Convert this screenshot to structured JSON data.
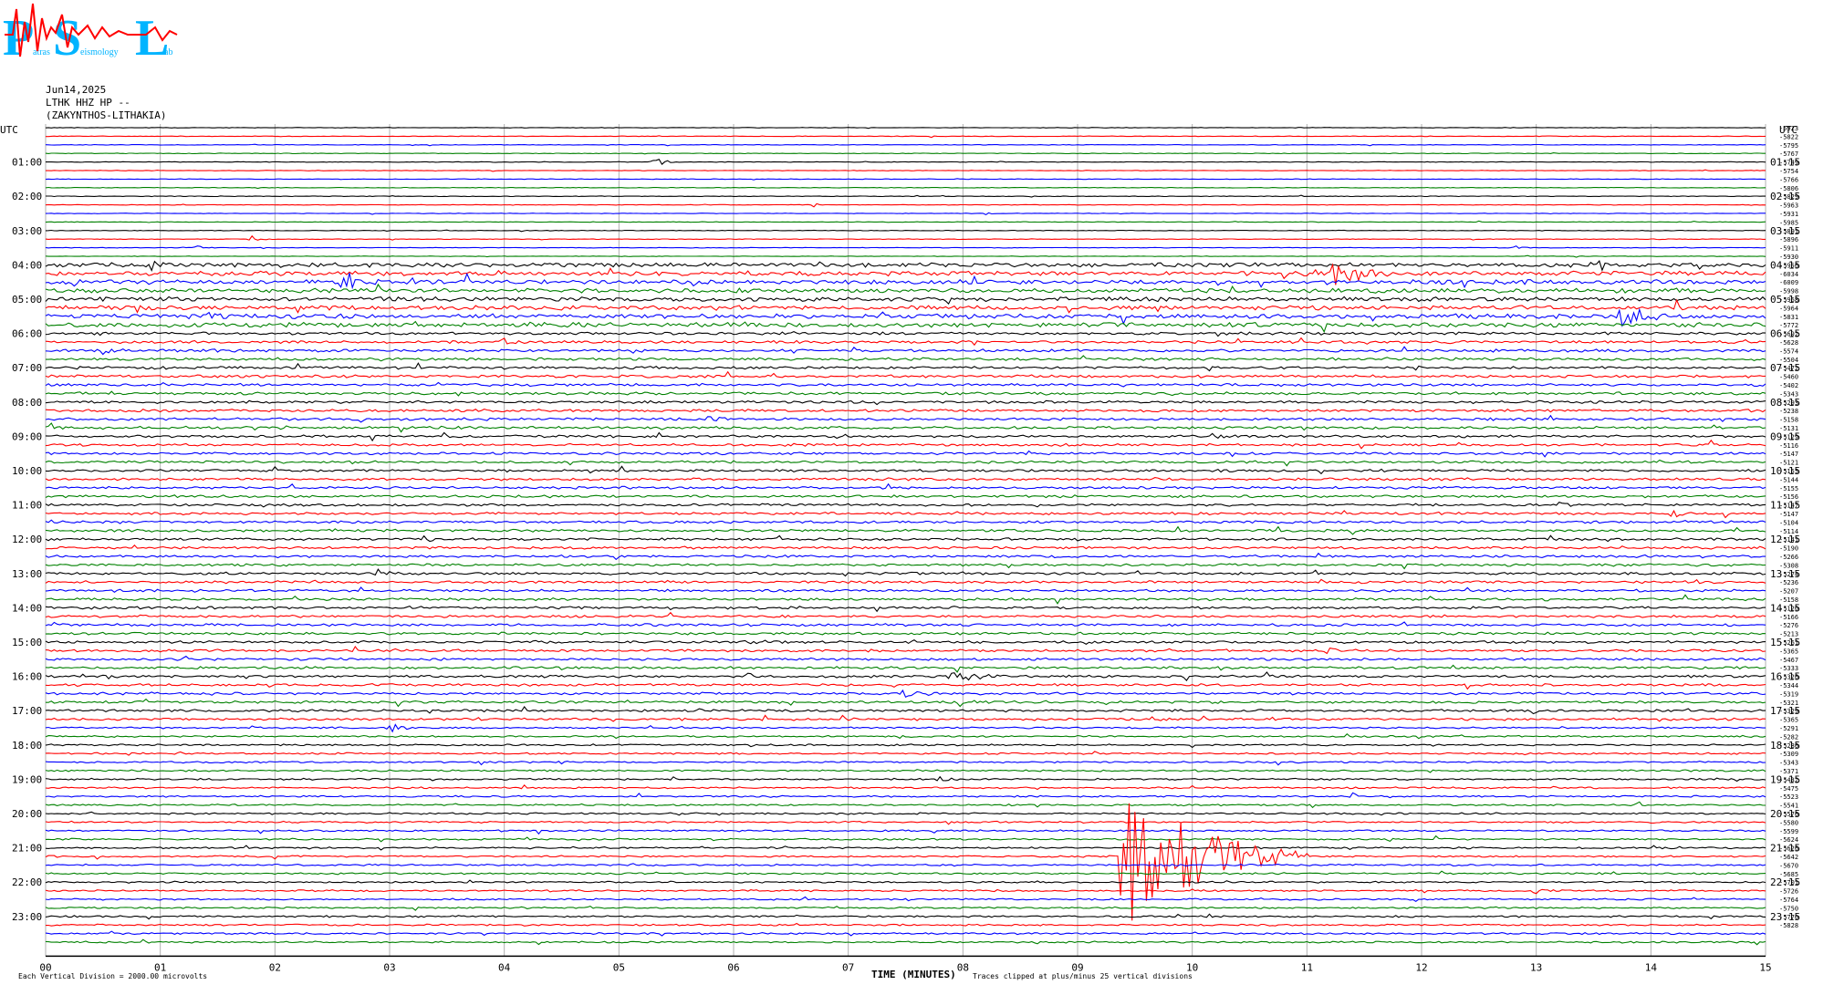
{
  "logo": {
    "big_letters": [
      "P",
      "S",
      "L"
    ],
    "small_words": [
      "atras",
      "eismology",
      "ab"
    ],
    "colors": {
      "letters": "#00b4ff",
      "wave": "#ff0000"
    }
  },
  "header": {
    "date": "Jun14,2025",
    "station": "LTHK HHZ HP --",
    "location": "(ZAKYNTHOS-LITHAKIA)"
  },
  "chart_data": {
    "type": "seismogram",
    "utc_label_left": "UTC",
    "utc_label_right": "UTC",
    "xlabel": "TIME (MINUTES)",
    "xlim": [
      0,
      15
    ],
    "x_ticks": [
      "00",
      "01",
      "02",
      "03",
      "04",
      "05",
      "06",
      "07",
      "08",
      "09",
      "10",
      "11",
      "12",
      "13",
      "14",
      "15"
    ],
    "left_hours": [
      "01:00",
      "02:00",
      "03:00",
      "04:00",
      "05:00",
      "06:00",
      "07:00",
      "08:00",
      "09:00",
      "10:00",
      "11:00",
      "12:00",
      "13:00",
      "14:00",
      "15:00",
      "16:00",
      "17:00",
      "18:00",
      "19:00",
      "20:00",
      "21:00",
      "22:00",
      "23:00"
    ],
    "right_hours": [
      "01:15",
      "02:15",
      "03:15",
      "04:15",
      "05:15",
      "06:15",
      "07:15",
      "08:15",
      "09:15",
      "10:15",
      "11:15",
      "12:15",
      "13:15",
      "14:15",
      "15:15",
      "16:15",
      "17:15",
      "18:15",
      "19:15",
      "20:15",
      "21:15",
      "22:15",
      "23:15"
    ],
    "trace_count": 96,
    "trace_colors": [
      "#000000",
      "#ff0000",
      "#0000ff",
      "#008000"
    ],
    "trace_offsets": [
      -5923,
      -5822,
      -5795,
      -5767,
      -5749,
      -5754,
      -5766,
      -5806,
      -5829,
      -5963,
      -5931,
      -5985,
      -5891,
      -5896,
      -5911,
      -5930,
      -5956,
      -6034,
      -6009,
      -5998,
      -5968,
      -5964,
      -5831,
      -5772,
      -5692,
      -5628,
      -5574,
      -5504,
      -5472,
      -5460,
      -5402,
      -5343,
      -5293,
      -5238,
      -5158,
      -5131,
      -5129,
      -5116,
      -5147,
      -5121,
      -5155,
      -5144,
      -5155,
      -5156,
      -5147,
      -5147,
      -5104,
      -5114,
      -5141,
      -5190,
      -5266,
      -5308,
      -5274,
      -5236,
      -5207,
      -5158,
      -5120,
      -5166,
      -5276,
      -5213,
      -5261,
      -5365,
      -5467,
      -5333,
      -5326,
      -5344,
      -5319,
      -5321,
      -5329,
      -5365,
      -5291,
      -5282,
      -5286,
      -5309,
      -5343,
      -5371,
      -5432,
      -5475,
      -5523,
      -5541,
      -5576,
      -5580,
      -5599,
      -5624,
      -5626,
      -5642,
      -5670,
      -5685,
      -5701,
      -5726,
      -5764,
      -5750,
      -5770,
      -5828
    ],
    "footer_left": "Each Vertical Division = 2000.00 microvolts",
    "footer_right": "Traces clipped at plus/minus 25 vertical divisions",
    "events": [
      {
        "trace": 4,
        "minute": 5.3,
        "amp": 0.8,
        "dur": 0.25
      },
      {
        "trace": 9,
        "minute": 6.7,
        "amp": 0.25,
        "dur": 0.1
      },
      {
        "trace": 10,
        "minute": 8.2,
        "amp": 0.25,
        "dur": 0.1
      },
      {
        "trace": 13,
        "minute": 1.8,
        "amp": 0.45,
        "dur": 0.2
      },
      {
        "trace": 14,
        "minute": 1.3,
        "amp": 0.3,
        "dur": 0.2
      },
      {
        "trace": 14,
        "minute": 12.8,
        "amp": 0.3,
        "dur": 0.15
      },
      {
        "trace": 16,
        "minute": 0.9,
        "amp": 0.6,
        "dur": 0.2
      },
      {
        "trace": 17,
        "minute": 11.25,
        "amp": 2.5,
        "dur": 0.45
      },
      {
        "trace": 18,
        "minute": 2.6,
        "amp": 1.5,
        "dur": 0.45
      },
      {
        "trace": 22,
        "minute": 13.75,
        "amp": 1.2,
        "dur": 0.45
      },
      {
        "trace": 22,
        "minute": 1.4,
        "amp": 0.5,
        "dur": 0.2
      },
      {
        "trace": 25,
        "minute": 4.0,
        "amp": 0.4,
        "dur": 0.2
      },
      {
        "trace": 26,
        "minute": 0.5,
        "amp": 0.4,
        "dur": 0.2
      },
      {
        "trace": 34,
        "minute": 5.8,
        "amp": 0.5,
        "dur": 0.2
      },
      {
        "trace": 35,
        "minute": 0.05,
        "amp": 0.6,
        "dur": 0.2
      },
      {
        "trace": 36,
        "minute": 10.2,
        "amp": 0.5,
        "dur": 0.15
      },
      {
        "trace": 44,
        "minute": 13.2,
        "amp": 0.4,
        "dur": 0.2
      },
      {
        "trace": 45,
        "minute": 14.2,
        "amp": 0.5,
        "dur": 0.2
      },
      {
        "trace": 48,
        "minute": 3.3,
        "amp": 0.4,
        "dur": 0.25
      },
      {
        "trace": 52,
        "minute": 2.9,
        "amp": 0.4,
        "dur": 0.2
      },
      {
        "trace": 56,
        "minute": 3.2,
        "amp": 0.4,
        "dur": 0.2
      },
      {
        "trace": 60,
        "minute": 6.1,
        "amp": 0.45,
        "dur": 0.5
      },
      {
        "trace": 61,
        "minute": 11.2,
        "amp": 0.4,
        "dur": 0.15
      },
      {
        "trace": 64,
        "minute": 7.9,
        "amp": 0.7,
        "dur": 0.6
      },
      {
        "trace": 66,
        "minute": 7.5,
        "amp": 0.5,
        "dur": 0.15
      },
      {
        "trace": 70,
        "minute": 3.0,
        "amp": 0.8,
        "dur": 0.2
      },
      {
        "trace": 74,
        "minute": 4.5,
        "amp": 0.35,
        "dur": 0.2
      },
      {
        "trace": 76,
        "minute": 7.8,
        "amp": 0.35,
        "dur": 0.2
      },
      {
        "trace": 78,
        "minute": 11.4,
        "amp": 0.45,
        "dur": 0.1
      },
      {
        "trace": 79,
        "minute": 13.9,
        "amp": 0.35,
        "dur": 0.1
      },
      {
        "trace": 82,
        "minute": 3.2,
        "amp": 0.3,
        "dur": 0.1
      },
      {
        "trace": 85,
        "minute": 9.4,
        "amp": 12.0,
        "dur": 1.6
      },
      {
        "trace": 89,
        "minute": 13.0,
        "amp": 0.4,
        "dur": 0.15
      },
      {
        "trace": 92,
        "minute": 10.1,
        "amp": 0.35,
        "dur": 0.3
      }
    ]
  }
}
